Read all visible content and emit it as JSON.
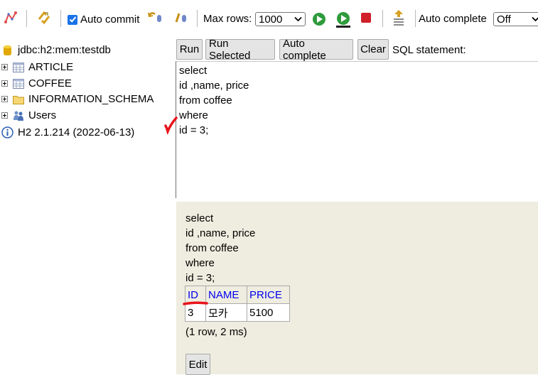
{
  "toolbar": {
    "auto_commit_label": "Auto commit",
    "auto_commit_checked": true,
    "max_rows_label": "Max rows:",
    "max_rows_value": "1000",
    "auto_complete_label": "Auto complete",
    "auto_complete_value": "Off",
    "icons": [
      "disconnect-icon",
      "refresh-icon",
      "rollback-icon",
      "commit-icon",
      "run-icon",
      "run-selected-icon",
      "stop-icon",
      "history-icon"
    ]
  },
  "tree": {
    "connection": "jdbc:h2:mem:testdb",
    "items": [
      {
        "label": "ARTICLE",
        "icon": "table-icon"
      },
      {
        "label": "COFFEE",
        "icon": "table-icon"
      },
      {
        "label": "INFORMATION_SCHEMA",
        "icon": "folder-icon"
      },
      {
        "label": "Users",
        "icon": "users-icon"
      }
    ],
    "version": "H2 2.1.214 (2022-06-13)"
  },
  "sql_buttons": {
    "run": "Run",
    "run_selected": "Run Selected",
    "auto_complete": "Auto complete",
    "clear": "Clear",
    "statement_label": "SQL statement:"
  },
  "editor": {
    "lines": [
      "select",
      "id ,name, price",
      "from coffee",
      "where",
      "id = 3;"
    ]
  },
  "result": {
    "query_lines": [
      "select",
      "id ,name, price",
      "from coffee",
      "where",
      "id = 3;"
    ],
    "columns": [
      "ID",
      "NAME",
      "PRICE"
    ],
    "rows": [
      [
        "3",
        "모카",
        "5100"
      ]
    ],
    "status": "(1 row, 2 ms)",
    "edit_label": "Edit"
  },
  "colors": {
    "result_bg": "#efeddf",
    "header_link": "#0000ee",
    "annotation": "#e8141b",
    "checkbox": "#1a73e8"
  }
}
